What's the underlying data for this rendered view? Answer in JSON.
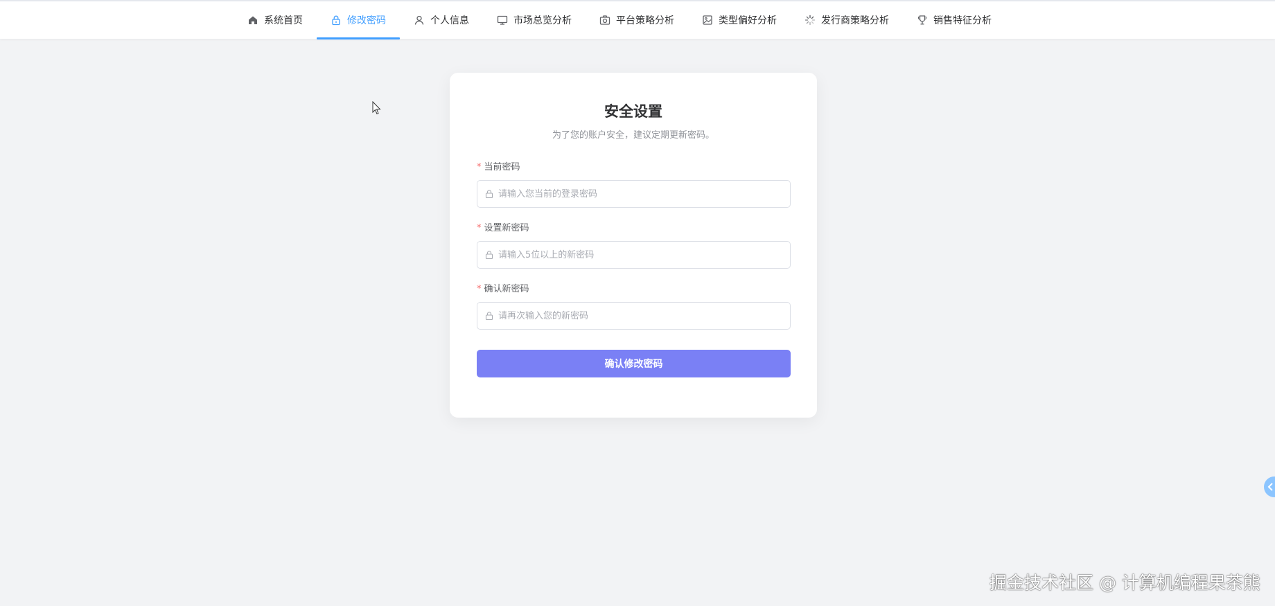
{
  "nav": {
    "items": [
      {
        "label": "系统首页",
        "icon": "home-icon"
      },
      {
        "label": "修改密码",
        "icon": "lock-icon",
        "active": true
      },
      {
        "label": "个人信息",
        "icon": "user-icon"
      },
      {
        "label": "市场总览分析",
        "icon": "monitor-icon"
      },
      {
        "label": "平台策略分析",
        "icon": "camera-icon"
      },
      {
        "label": "类型偏好分析",
        "icon": "picture-icon"
      },
      {
        "label": "发行商策略分析",
        "icon": "loading-icon"
      },
      {
        "label": "销售特征分析",
        "icon": "trophy-icon"
      }
    ]
  },
  "security": {
    "title": "安全设置",
    "subtitle": "为了您的账户安全，建议定期更新密码。",
    "fields": [
      {
        "label": "当前密码",
        "placeholder": "请输入您当前的登录密码",
        "required": true,
        "value": ""
      },
      {
        "label": "设置新密码",
        "placeholder": "请输入5位以上的新密码",
        "required": true,
        "value": ""
      },
      {
        "label": "确认新密码",
        "placeholder": "请再次输入您的新密码",
        "required": true,
        "value": ""
      }
    ],
    "submit_label": "确认修改密码",
    "required_mark": "*"
  },
  "watermark": {
    "text": "掘金技术社区 @ 计算机编程果茶熊"
  },
  "colors": {
    "accent": "#409eff",
    "button": "#7a80f5",
    "required": "#f56c6c",
    "background": "#f2f3f5"
  }
}
